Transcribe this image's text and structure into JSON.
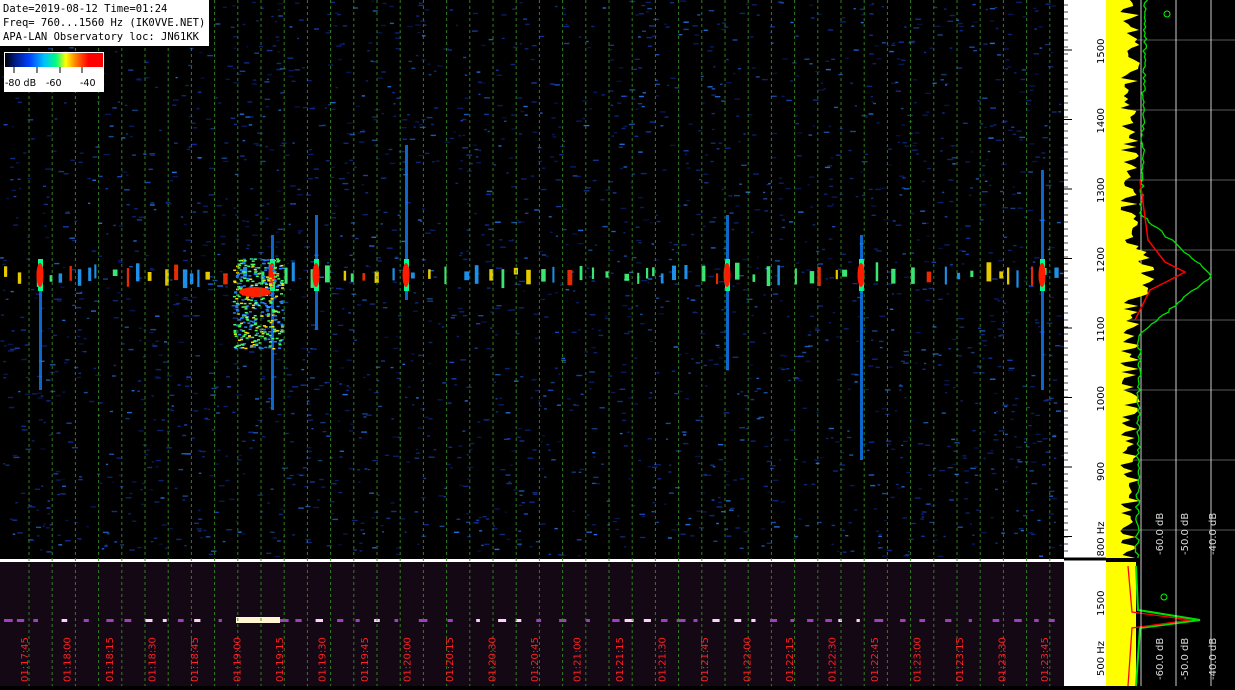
{
  "header": {
    "line1": "Date=2019-08-12 Time=01:24",
    "line2": "Freq= 760...1560 Hz (IK0VVE.NET)",
    "line3": "APA-LAN Observatory loc: JN61KK"
  },
  "colorbar": {
    "label_low": "-80 dB",
    "label_mid": "-60",
    "label_high": "-40"
  },
  "freq_axis": {
    "main_ticks": [
      "1500",
      "1400",
      "1300",
      "1200",
      "1100",
      "1000",
      "900",
      "800 Hz"
    ],
    "small_ticks": [
      "1500",
      "500 Hz"
    ]
  },
  "spectrum_axis": {
    "labels": [
      "-60.0 dB",
      "-50.0 dB",
      "-40.0 dB"
    ]
  },
  "time_axis": {
    "labels": [
      "01:17:45",
      "01:18:00",
      "01:18:15",
      "01:18:30",
      "01:18:45",
      "01:19:00",
      "01:19:15",
      "01:19:30",
      "01:19:45",
      "01:20:00",
      "01:20:15",
      "01:20:30",
      "01:20:45",
      "01:21:00",
      "01:21:15",
      "01:21:30",
      "01:21:45",
      "01:22:00",
      "01:22:15",
      "01:22:30",
      "01:22:45",
      "01:23:00",
      "01:23:15",
      "01:23:30",
      "01:23:45"
    ]
  },
  "colors": {
    "background": "#000000",
    "grid_time": "#3a8a2a",
    "time_label": "#ff2020",
    "avg_spectrum": "#00e000",
    "peak_spectrum": "#ffff00",
    "mean_spectrum": "#ff0000"
  }
}
